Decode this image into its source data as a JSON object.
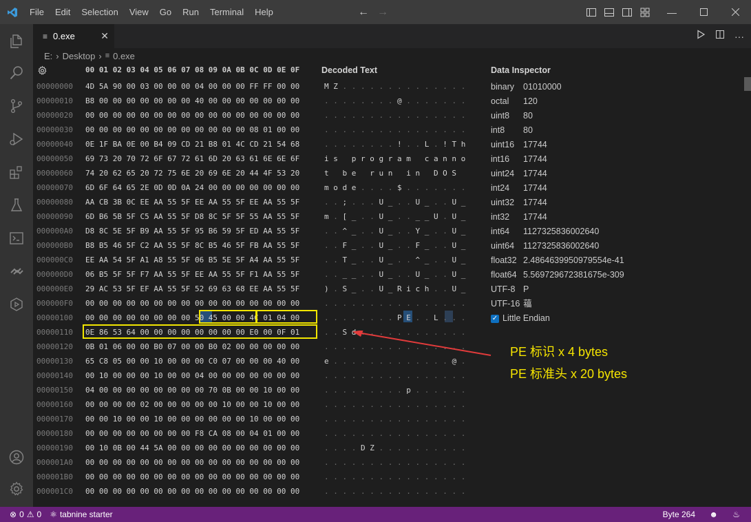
{
  "menu": [
    "File",
    "Edit",
    "Selection",
    "View",
    "Go",
    "Run",
    "Terminal",
    "Help"
  ],
  "tab": {
    "label": "0.exe"
  },
  "breadcrumb": [
    "E:",
    "Desktop",
    "0.exe"
  ],
  "hex_header": "00 01 02 03 04 05 06 07 08 09 0A 0B 0C 0D 0E 0F",
  "decoded_title": "Decoded Text",
  "inspector_title": "Data Inspector",
  "rows": [
    {
      "addr": "00000000",
      "hex": "4D 5A 90 00 03 00 00 00 04 00 00 00 FF FF 00 00",
      "dec": "M Z . . . . . . . . . . . . . ."
    },
    {
      "addr": "00000010",
      "hex": "B8 00 00 00 00 00 00 00 40 00 00 00 00 00 00 00",
      "dec": ". . . . . . . . @ . . . . . . ."
    },
    {
      "addr": "00000020",
      "hex": "00 00 00 00 00 00 00 00 00 00 00 00 00 00 00 00",
      "dec": ". . . . . . . . . . . . . . . ."
    },
    {
      "addr": "00000030",
      "hex": "00 00 00 00 00 00 00 00 00 00 00 00 08 01 00 00",
      "dec": ". . . . . . . . . . . . . . . ."
    },
    {
      "addr": "00000040",
      "hex": "0E 1F BA 0E 00 B4 09 CD 21 B8 01 4C CD 21 54 68",
      "dec": ". . . . . . . . ! . . L . ! T h"
    },
    {
      "addr": "00000050",
      "hex": "69 73 20 70 72 6F 67 72 61 6D 20 63 61 6E 6E 6F",
      "dec": "i s   p r o g r a m   c a n n o"
    },
    {
      "addr": "00000060",
      "hex": "74 20 62 65 20 72 75 6E 20 69 6E 20 44 4F 53 20",
      "dec": "t   b e   r u n   i n   D O S  "
    },
    {
      "addr": "00000070",
      "hex": "6D 6F 64 65 2E 0D 0D 0A 24 00 00 00 00 00 00 00",
      "dec": "m o d e . . . . $ . . . . . . ."
    },
    {
      "addr": "00000080",
      "hex": "AA CB 3B 0C EE AA 55 5F EE AA 55 5F EE AA 55 5F",
      "dec": ". . ; . . . U _ . . U _ . . U _"
    },
    {
      "addr": "00000090",
      "hex": "6D B6 5B 5F C5 AA 55 5F D8 8C 5F 5F 55 AA 55 5F",
      "dec": "m . [ _ . . U _ . . _ _ U . U _"
    },
    {
      "addr": "000000A0",
      "hex": "D8 8C 5E 5F B9 AA 55 5F 95 B6 59 5F ED AA 55 5F",
      "dec": ". . ^ _ . . U _ . . Y _ . . U _"
    },
    {
      "addr": "000000B0",
      "hex": "B8 B5 46 5F C2 AA 55 5F 8C B5 46 5F FB AA 55 5F",
      "dec": ". . F _ . . U _ . . F _ . . U _"
    },
    {
      "addr": "000000C0",
      "hex": "EE AA 54 5F A1 A8 55 5F 06 B5 5E 5F A4 AA 55 5F",
      "dec": ". . T _ . . U _ . . ^ _ . . U _"
    },
    {
      "addr": "000000D0",
      "hex": "06 B5 5F 5F F7 AA 55 5F EE AA 55 5F F1 AA 55 5F",
      "dec": ". . _ _ . . U _ . . U _ . . U _"
    },
    {
      "addr": "000000E0",
      "hex": "29 AC 53 5F EF AA 55 5F 52 69 63 68 EE AA 55 5F",
      "dec": ") . S _ . . U _ R i c h . . U _"
    },
    {
      "addr": "000000F0",
      "hex": "00 00 00 00 00 00 00 00 00 00 00 00 00 00 00 00",
      "dec": ". . . . . . . . . . . . . . . ."
    },
    {
      "addr": "00000100",
      "hex": "00 00 00 00 00 00 00 00 50 45 00 00 4C 01 04 00",
      "dec": ". . . . . . . . P E . . L . . ."
    },
    {
      "addr": "00000110",
      "hex": "0E 86 53 64 00 00 00 00 00 00 00 00 E0 00 0F 01",
      "dec": ". . S d . . . . . . . . . . . ."
    },
    {
      "addr": "00000120",
      "hex": "0B 01 06 00 00 B0 07 00 00 B0 02 00 00 00 00 00",
      "dec": ". . . . . . . . . . . . . . . ."
    },
    {
      "addr": "00000130",
      "hex": "65 C8 05 00 00 10 00 00 00 C0 07 00 00 00 40 00",
      "dec": "e . . . . . . . . . . . . . @ ."
    },
    {
      "addr": "00000140",
      "hex": "00 10 00 00 00 10 00 00 04 00 00 00 00 00 00 00",
      "dec": ". . . . . . . . . . . . . . . ."
    },
    {
      "addr": "00000150",
      "hex": "04 00 00 00 00 00 00 00 00 70 0B 00 00 10 00 00",
      "dec": ". . . . . . . . . p . . . . . ."
    },
    {
      "addr": "00000160",
      "hex": "00 00 00 00 02 00 00 00 00 00 10 00 00 10 00 00",
      "dec": ". . . . . . . . . . . . . . . ."
    },
    {
      "addr": "00000170",
      "hex": "00 00 10 00 00 10 00 00 00 00 00 00 10 00 00 00",
      "dec": ". . . . . . . . . . . . . . . ."
    },
    {
      "addr": "00000180",
      "hex": "00 00 00 00 00 00 00 00 F8 CA 08 00 04 01 00 00",
      "dec": ". . . . . . . . . . . . . . . ."
    },
    {
      "addr": "00000190",
      "hex": "00 10 0B 00 44 5A 00 00 00 00 00 00 00 00 00 00",
      "dec": ". . . . D Z . . . . . . . . . ."
    },
    {
      "addr": "000001A0",
      "hex": "00 00 00 00 00 00 00 00 00 00 00 00 00 00 00 00",
      "dec": ". . . . . . . . . . . . . . . ."
    },
    {
      "addr": "000001B0",
      "hex": "00 00 00 00 00 00 00 00 00 00 00 00 00 00 00 00",
      "dec": ". . . . . . . . . . . . . . . ."
    },
    {
      "addr": "000001C0",
      "hex": "00 00 00 00 00 00 00 00 00 00 00 00 00 00 00 00",
      "dec": ". . . . . . . . . . . . . . . ."
    }
  ],
  "inspector": [
    {
      "key": "binary",
      "val": "01010000"
    },
    {
      "key": "octal",
      "val": "120"
    },
    {
      "key": "uint8",
      "val": "80"
    },
    {
      "key": "int8",
      "val": "80"
    },
    {
      "key": "uint16",
      "val": "17744"
    },
    {
      "key": "int16",
      "val": "17744"
    },
    {
      "key": "uint24",
      "val": "17744"
    },
    {
      "key": "int24",
      "val": "17744"
    },
    {
      "key": "uint32",
      "val": "17744"
    },
    {
      "key": "int32",
      "val": "17744"
    },
    {
      "key": "int64",
      "val": "1127325836002640"
    },
    {
      "key": "uint64",
      "val": "1127325836002640"
    },
    {
      "key": "float32",
      "val": "2.4864639950979554e-41"
    },
    {
      "key": "float64",
      "val": "5.569729672381675e-309"
    },
    {
      "key": "UTF-8",
      "val": "P"
    },
    {
      "key": "UTF-16",
      "val": "䕐"
    }
  ],
  "little_endian_label": "Little Endian",
  "annotations": [
    "PE 标识 x 4 bytes",
    "PE 标准头 x 20 bytes"
  ],
  "status": {
    "errors": "0",
    "warnings": "0",
    "tabnine": "tabnine starter",
    "byte": "Byte 264"
  },
  "colors": {
    "statusbar": "#68217a",
    "highlight": "#f2e600",
    "selection": "#264f78"
  }
}
